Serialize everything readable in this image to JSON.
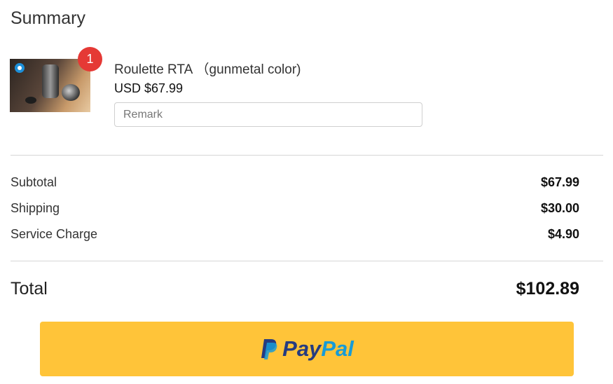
{
  "summary": {
    "title": "Summary"
  },
  "product": {
    "name": "Roulette RTA （gunmetal color)",
    "price": "USD $67.99",
    "quantity": "1",
    "remark_placeholder": "Remark",
    "remark_value": ""
  },
  "totals": {
    "subtotal_label": "Subtotal",
    "subtotal_value": "$67.99",
    "shipping_label": "Shipping",
    "shipping_value": "$30.00",
    "service_label": "Service Charge",
    "service_value": "$4.90",
    "total_label": "Total",
    "total_value": "$102.89"
  },
  "payment": {
    "button_text_pay": "Pay",
    "button_text_pal": "Pal",
    "icon": "paypal-icon"
  },
  "colors": {
    "badge": "#e53935",
    "paypal_button": "#ffc439",
    "paypal_dark": "#253b80",
    "paypal_light": "#179bd7"
  }
}
